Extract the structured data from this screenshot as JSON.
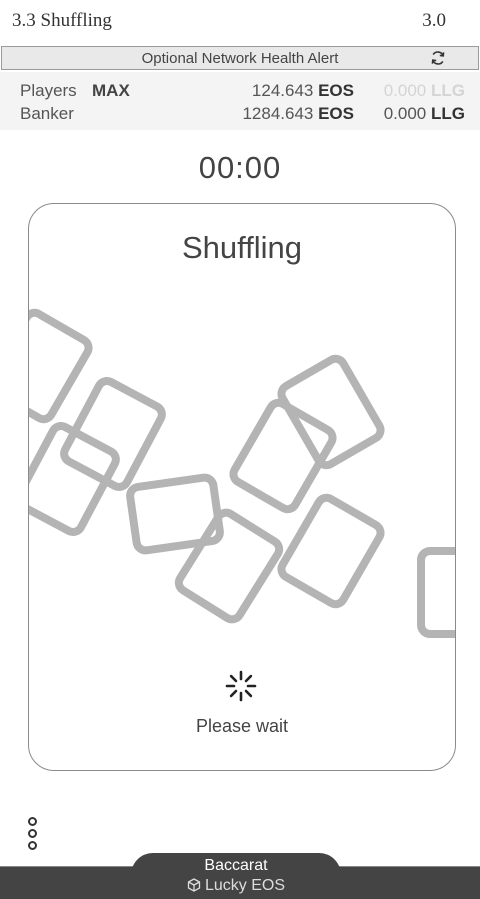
{
  "header": {
    "title": "3.3 Shuffling",
    "version": "3.0"
  },
  "alert": {
    "text": "Optional Network Health Alert",
    "icon": "refresh-icon"
  },
  "stats": {
    "players": {
      "label": "Players",
      "badge": "MAX",
      "eos_amount": "124.643",
      "eos_unit": "EOS",
      "llg_amount": "0.000",
      "llg_unit": "LLG"
    },
    "banker": {
      "label": "Banker",
      "eos_amount": "1284.643",
      "eos_unit": "EOS",
      "llg_amount": "0.000",
      "llg_unit": "LLG"
    }
  },
  "timer": "00:00",
  "panel": {
    "heading": "Shuffling",
    "status": "Please wait",
    "spinner_icon": "loading-spinner-icon"
  },
  "menu": {
    "icon": "more-vertical-icon"
  },
  "footer": {
    "game": "Baccarat",
    "brand": "Lucky EOS",
    "brand_icon": "cube-icon"
  },
  "colors": {
    "card_stroke": "#b4b4b4",
    "footer_bg": "#444444",
    "alert_bg": "#e9e9e9",
    "stats_bg": "#f4f4f4"
  }
}
